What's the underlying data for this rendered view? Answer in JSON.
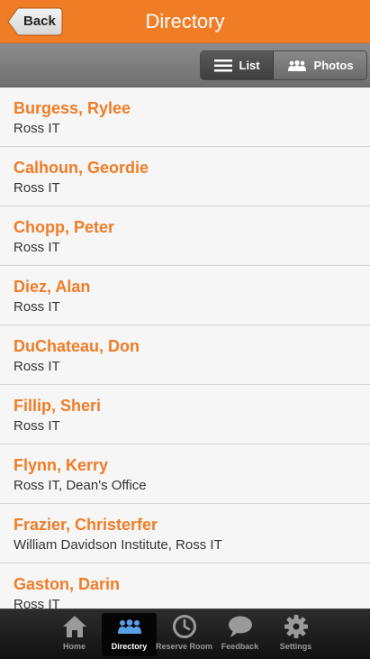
{
  "header": {
    "back_label": "Back",
    "title": "Directory"
  },
  "view_toggle": {
    "list_label": "List",
    "photos_label": "Photos",
    "selected": "List"
  },
  "entries": [
    {
      "name": "Burgess, Rylee",
      "dept": "Ross IT"
    },
    {
      "name": "Calhoun, Geordie",
      "dept": "Ross IT"
    },
    {
      "name": "Chopp, Peter",
      "dept": "Ross IT"
    },
    {
      "name": "Diez, Alan",
      "dept": "Ross IT"
    },
    {
      "name": "DuChateau, Don",
      "dept": "Ross IT"
    },
    {
      "name": "Fillip, Sheri",
      "dept": "Ross IT"
    },
    {
      "name": "Flynn, Kerry",
      "dept": "Ross IT, Dean's Office"
    },
    {
      "name": "Frazier, Christerfer",
      "dept": "William Davidson Institute, Ross IT"
    },
    {
      "name": "Gaston, Darin",
      "dept": "Ross IT"
    }
  ],
  "tabbar": {
    "tabs": [
      {
        "label": "Home",
        "icon": "home-icon"
      },
      {
        "label": "Directory",
        "icon": "people-icon"
      },
      {
        "label": "Reserve Room",
        "icon": "clock-icon"
      },
      {
        "label": "Feedback",
        "icon": "speech-bubble-icon"
      },
      {
        "label": "Settings",
        "icon": "gear-icon"
      }
    ],
    "active": "Directory"
  },
  "colors": {
    "accent": "#f07c26",
    "toolbar": "#7d7d7d",
    "tabbar": "#1e1e1e"
  }
}
